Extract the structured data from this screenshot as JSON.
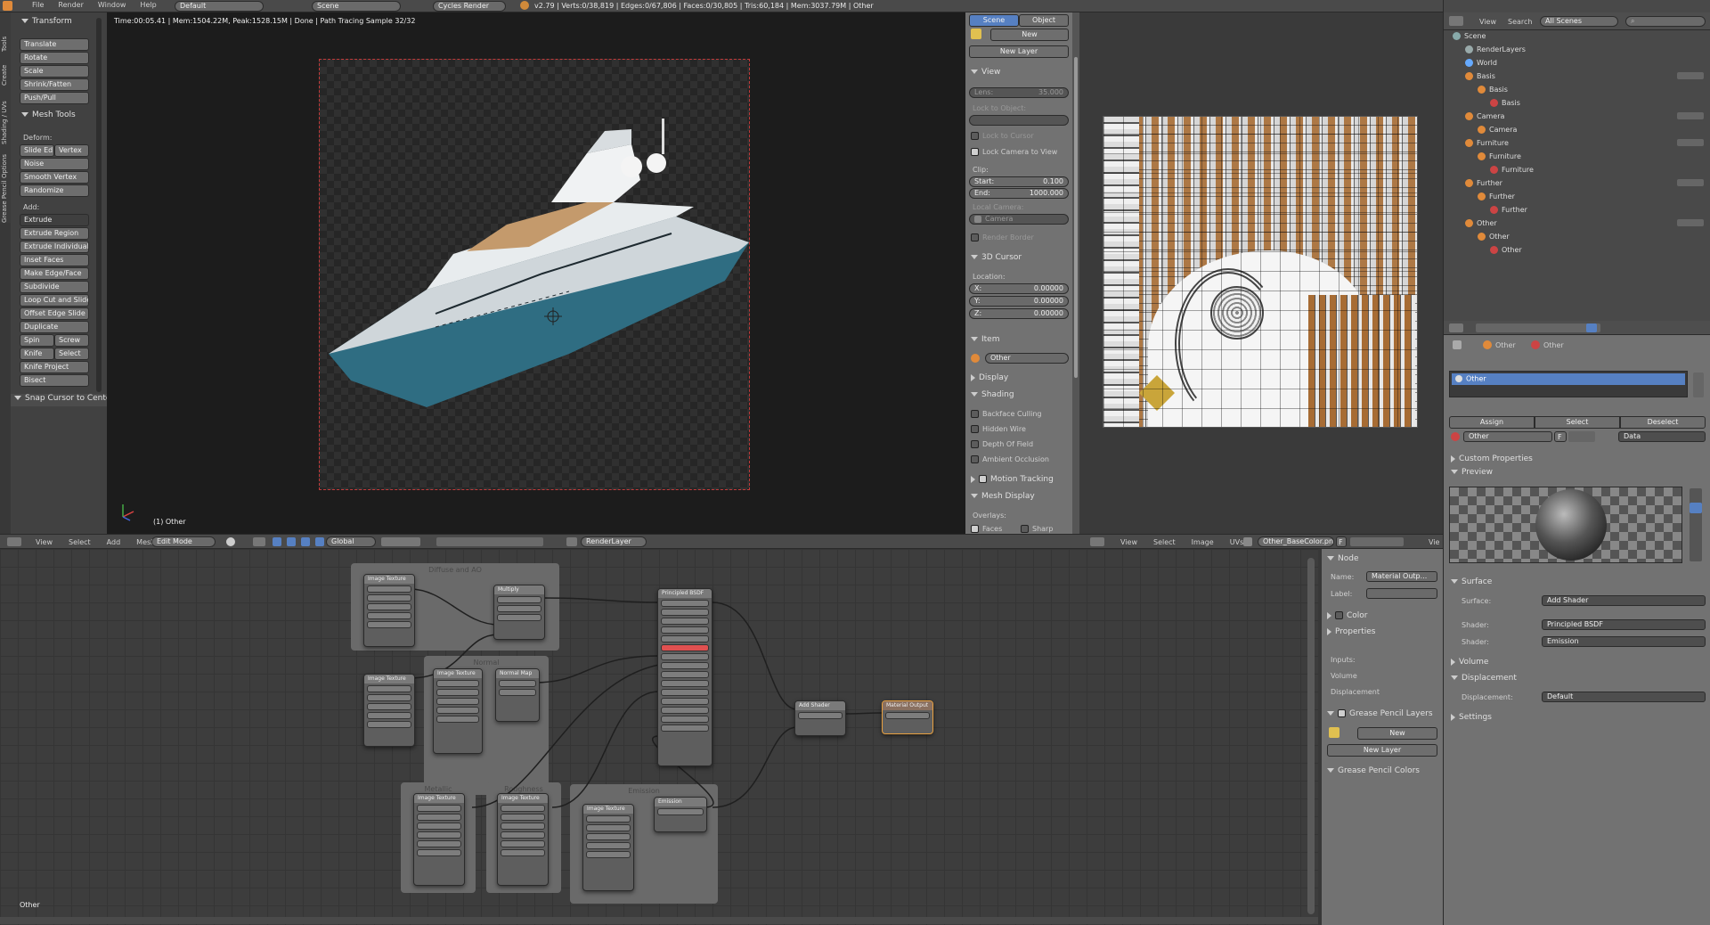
{
  "top_bar": {
    "menu": [
      "File",
      "Render",
      "Window",
      "Help"
    ],
    "screen_layout": "Default",
    "scene": "Scene",
    "engine": "Cycles Render",
    "stats": "v2.79 | Verts:0/38,819 | Edges:0/67,806 | Faces:0/30,805 | Tris:60,184 | Mem:3037.79M | Other"
  },
  "side_tabs": [
    "Tools",
    "Create",
    "Shading / UVs",
    "Options",
    "Grease Pencil"
  ],
  "tool_shelf": {
    "transform_header": "Transform",
    "transform_buttons": [
      "Translate",
      "Rotate",
      "Scale",
      "Shrink/Fatten",
      "Push/Pull"
    ],
    "mesh_tools_header": "Mesh Tools",
    "deform_label": "Deform:",
    "slide_edge": "Slide Ed",
    "vertex": "Vertex",
    "deform_buttons": [
      "Noise",
      "Smooth Vertex",
      "Randomize"
    ],
    "add_label": "Add:",
    "extrude_select": "Extrude",
    "add_buttons": [
      "Extrude Region",
      "Extrude Individual",
      "Inset Faces",
      "Make Edge/Face",
      "Subdivide",
      "Loop Cut and Slide",
      "Offset Edge Slide",
      "Duplicate"
    ],
    "spin": "Spin",
    "screw": "Screw",
    "knife": "Knife",
    "select": "Select",
    "knife_project": "Knife Project",
    "bisect": "Bisect",
    "snap_header": "Snap Cursor to Center"
  },
  "viewport": {
    "render_info": "Time:00:05.41 | Mem:1504.22M, Peak:1528.15M | Done | Path Tracing Sample 32/32",
    "object_label": "(1) Other",
    "header": {
      "menus": [
        "View",
        "Select",
        "Add",
        "Mesh"
      ],
      "mode": "Edit Mode",
      "orientation": "Global",
      "render_layer": "RenderLayer"
    }
  },
  "n_panel": {
    "tabs": [
      "Scene",
      "Object"
    ],
    "new_button": "New",
    "new_layer_button": "New Layer",
    "view_header": "View",
    "lens_label": "Lens:",
    "lens_value": "35.000",
    "lock_to_object": "Lock to Object:",
    "lock_to_cursor": "Lock to Cursor",
    "lock_camera": "Lock Camera to View",
    "clip_label": "Clip:",
    "start_label": "Start:",
    "start_value": "0.100",
    "end_label": "End:",
    "end_value": "1000.000",
    "local_camera": "Local Camera:",
    "camera": "Camera",
    "render_border": "Render Border",
    "cursor_header": "3D Cursor",
    "location_label": "Location:",
    "x_label": "X:",
    "x_value": "0.00000",
    "y_label": "Y:",
    "y_value": "0.00000",
    "z_label": "Z:",
    "z_value": "0.00000",
    "item_header": "Item",
    "item_name": "Other",
    "display_header": "Display",
    "shading_header": "Shading",
    "shading_options": [
      "Backface Culling",
      "Hidden Wire",
      "Depth Of Field",
      "Ambient Occlusion"
    ],
    "motion_tracking": "Motion Tracking",
    "mesh_display": "Mesh Display",
    "overlays": "Overlays:",
    "faces": "Faces",
    "sharp": "Sharp"
  },
  "uv_editor": {
    "menus": [
      "View",
      "Select",
      "Image",
      "UVs"
    ],
    "image_name": "Other_BaseColor.png",
    "f_label": "F",
    "view_tail": "Vie"
  },
  "outliner": {
    "menus": [
      "View",
      "Search"
    ],
    "filter": "All Scenes",
    "items": [
      {
        "label": "Scene",
        "depth": 0
      },
      {
        "label": "RenderLayers",
        "depth": 1
      },
      {
        "label": "World",
        "depth": 1
      },
      {
        "label": "Basis",
        "depth": 1
      },
      {
        "label": "Basis",
        "depth": 2
      },
      {
        "label": "Basis",
        "depth": 3
      },
      {
        "label": "Camera",
        "depth": 1
      },
      {
        "label": "Camera",
        "depth": 2
      },
      {
        "label": "Furniture",
        "depth": 1
      },
      {
        "label": "Furniture",
        "depth": 2
      },
      {
        "label": "Furniture",
        "depth": 3
      },
      {
        "label": "Further",
        "depth": 1
      },
      {
        "label": "Further",
        "depth": 2
      },
      {
        "label": "Further",
        "depth": 3
      },
      {
        "label": "Other",
        "depth": 1
      },
      {
        "label": "Other",
        "depth": 2
      },
      {
        "label": "Other",
        "depth": 3
      }
    ]
  },
  "properties": {
    "breadcrumb": [
      "Other",
      "Other"
    ],
    "material_slot": "Other",
    "assign": "Assign",
    "select": "Select",
    "deselect": "Deselect",
    "material_name": "Other",
    "f_label": "F",
    "data": "Data",
    "custom_properties": "Custom Properties",
    "preview": "Preview",
    "surface_header": "Surface",
    "surface_label": "Surface:",
    "surface_value": "Add Shader",
    "shader_label": "Shader:",
    "shader1": "Principled BSDF",
    "shader2": "Emission",
    "volume_header": "Volume",
    "displacement_header": "Displacement",
    "displacement_label": "Displacement:",
    "displacement_value": "Default",
    "settings_header": "Settings"
  },
  "node_editor": {
    "frame_label": "Other",
    "frames": [
      "Diffuse and AO",
      "Normal",
      "Metallic",
      "Roughness",
      "Emission"
    ],
    "nodes": {
      "image_texture": "Image Texture",
      "multiply": "Multiply",
      "normal_map": "Normal Map",
      "principled": "Principled BSDF",
      "add_shader": "Add Shader",
      "output": "Material Output",
      "emission": "Emission"
    }
  },
  "node_sidebar": {
    "node_header": "Node",
    "name_label": "Name:",
    "name_value": "Material Outp...",
    "label_label": "Label:",
    "color_header": "Color",
    "properties_header": "Properties",
    "inputs": [
      "Inputs:",
      "Volume",
      "Displacement"
    ],
    "grease_layers": "Grease Pencil Layers",
    "new_button": "New",
    "new_layer": "New Layer",
    "grease_colors": "Grease Pencil Colors"
  },
  "colors": {
    "accent_blue": "#5680c2",
    "render_border": "#c23a3a",
    "hull_blue": "#2f6d82",
    "wood": "#b0773b"
  }
}
